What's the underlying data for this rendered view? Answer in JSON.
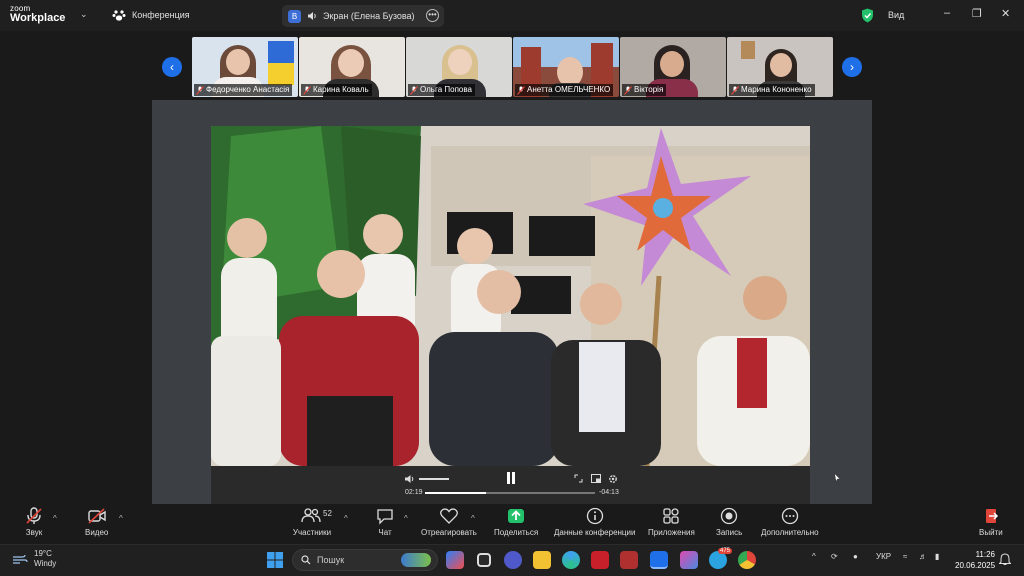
{
  "titlebar": {
    "logo_top": "zoom",
    "logo_bottom": "Workplace",
    "conference_label": "Конференция",
    "screen_badge": "В",
    "screen_label": "Экран (Елена Бузова)",
    "view_label": "Вид"
  },
  "participants": [
    {
      "name": "Федорченко Анастасія",
      "bg": "#d9e3ee"
    },
    {
      "name": "Карина Коваль",
      "bg": "#e8e4e0"
    },
    {
      "name": "Ольга Попова",
      "bg": "#d8d9d6"
    },
    {
      "name": "Анетта ОМЕЛЬЧЕНКО",
      "bg": "#8a4a3c"
    },
    {
      "name": "Вікторія",
      "bg": "#b1a9a4"
    },
    {
      "name": "Марина Кононенко",
      "bg": "#c9c4c0"
    }
  ],
  "player": {
    "elapsed": "02:19",
    "remaining": "-04:13",
    "progress_fraction": 0.36
  },
  "toolbar": {
    "audio": "Звук",
    "video": "Видео",
    "participants": "Участники",
    "participants_count": "52",
    "chat": "Чат",
    "react": "Отреагировать",
    "share": "Поделиться",
    "info": "Данные конференции",
    "apps": "Приложения",
    "record": "Запись",
    "more": "Дополнительно",
    "leave": "Выйти"
  },
  "taskbar": {
    "temp": "19°C",
    "weather": "Windy",
    "search_placeholder": "Пошук",
    "lang": "УКР",
    "time": "11:26",
    "date": "20.06.2025",
    "badge_telegram": "475"
  },
  "colors": {
    "accent": "#1e6fe8",
    "share_green": "#23c16b",
    "muted_red": "#e0453a"
  }
}
